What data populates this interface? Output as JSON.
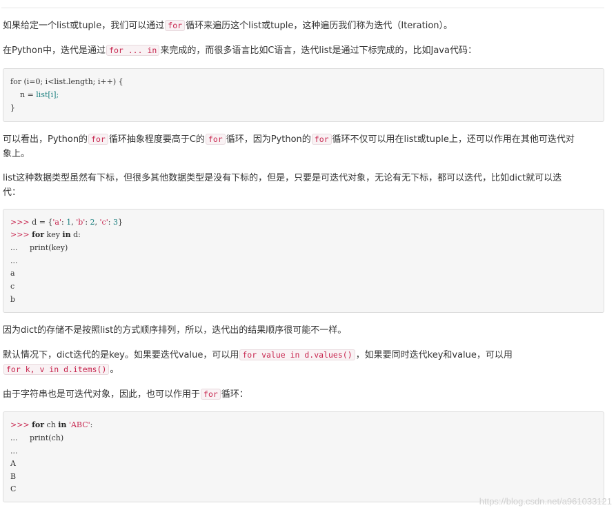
{
  "p1": {
    "a": "如果给定一个list或tuple，我们可以通过",
    "c1": "for",
    "b": "循环来遍历这个list或tuple，这种遍历我们称为迭代（Iteration）。"
  },
  "p2": {
    "a": "在Python中，迭代是通过",
    "c1": "for ... in",
    "b": "来完成的，而很多语言比如C语言，迭代list是通过下标完成的，比如Java代码："
  },
  "code1": {
    "l1": "for (i=0; i<list.length; i++) {",
    "l2a": "    n = ",
    "l2b": "list[i];",
    "l3": "}"
  },
  "p3": {
    "a": "可以看出，Python的",
    "c1": "for",
    "b": "循环抽象程度要高于C的",
    "c2": "for",
    "c": "循环，因为Python的",
    "c3": "for",
    "d": "循环不仅可以用在list或tuple上，还可以作用在其他可迭代对",
    "e": "象上。"
  },
  "p4": {
    "a": "list这种数据类型虽然有下标，但很多其他数据类型是没有下标的，但是，只要是可迭代对象，无论有无下标，都可以迭代，比如dict就可以迭",
    "b": "代："
  },
  "code2": {
    "prompt": ">>>",
    "cont": "...",
    "l1a": " d = {",
    "l1s1": "'a'",
    "l1b": ": ",
    "l1n1": "1",
    "l1c": ", ",
    "l1s2": "'b'",
    "l1d": ": ",
    "l1n2": "2",
    "l1e": ", ",
    "l1s3": "'c'",
    "l1f": ": ",
    "l1n3": "3",
    "l1g": "}",
    "kw_for": "for",
    "kw_in": "in",
    "l2a": " key ",
    "l2b": " d:",
    "l3": "     print(key)",
    "o1": "a",
    "o2": "c",
    "o3": "b"
  },
  "p5": {
    "a": "因为dict的存储不是按照list的方式顺序排列，所以，迭代出的结果顺序很可能不一样。"
  },
  "p6": {
    "a": "默认情况下，dict迭代的是key。如果要迭代value，可以用",
    "c1": "for value in d.values()",
    "b": "，如果要同时迭代key和value，可以用",
    "c2": "for k, v in d.items()",
    "c": "。"
  },
  "p7": {
    "a": "由于字符串也是可迭代对象，因此，也可以作用于",
    "c1": "for",
    "b": "循环："
  },
  "code3": {
    "prompt": ">>>",
    "cont": "...",
    "kw_for": "for",
    "kw_in": "in",
    "l1a": " ch ",
    "l1s": "'ABC'",
    "l1b": ":",
    "l2": "     print(ch)",
    "o1": "A",
    "o2": "B",
    "o3": "C"
  },
  "watermark": "https://blog.csdn.net/a961033121"
}
